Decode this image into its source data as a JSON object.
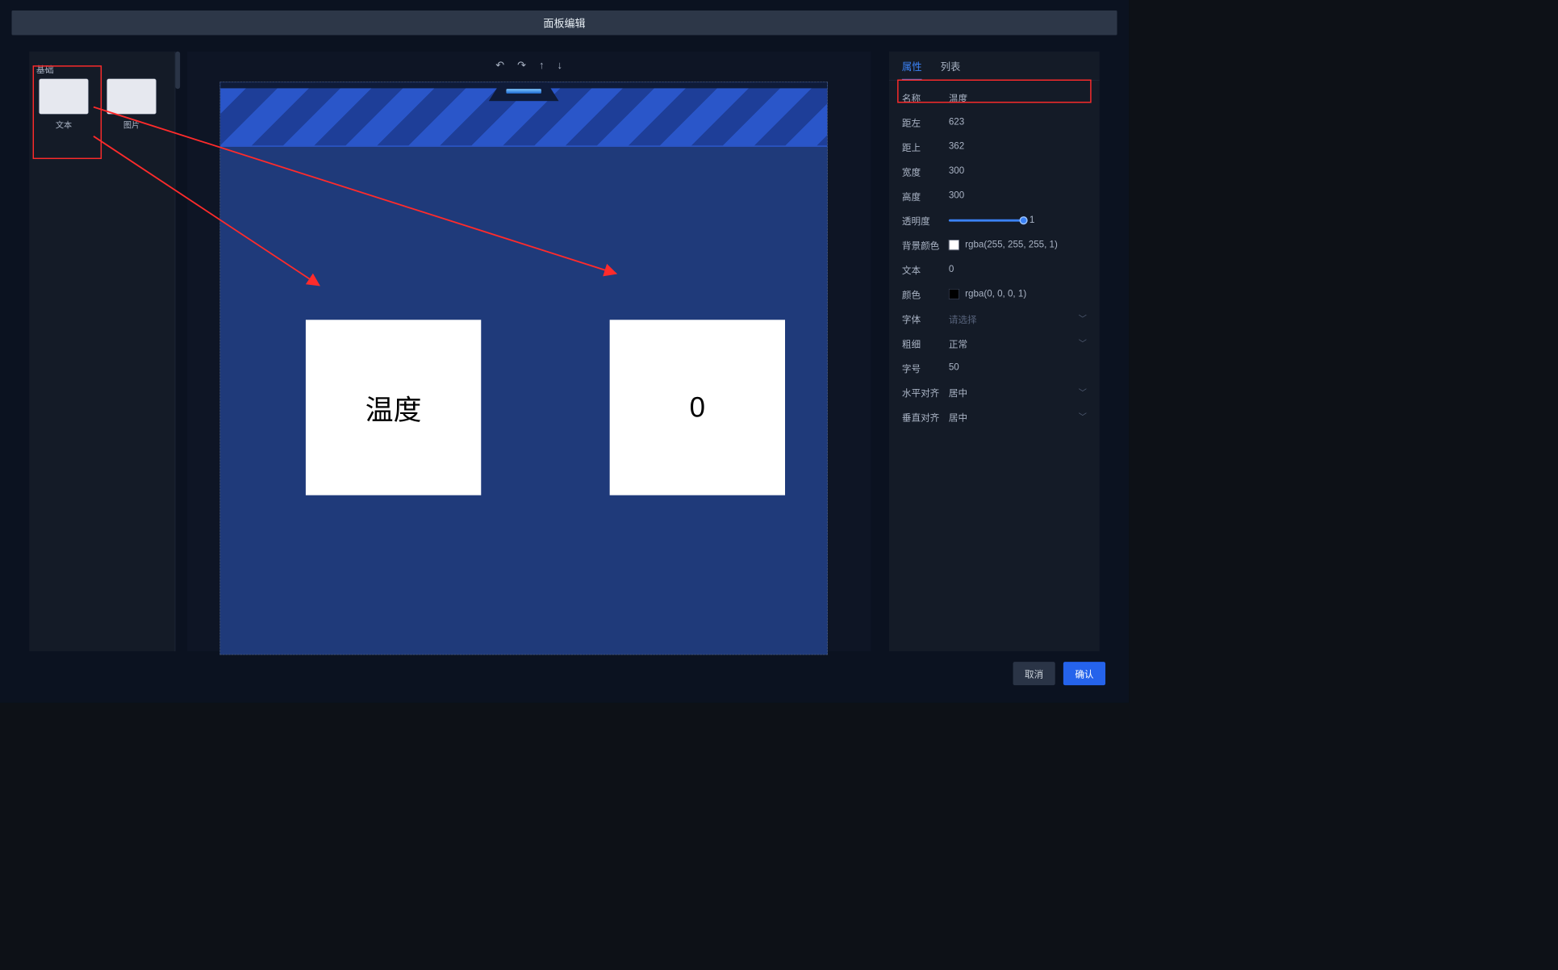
{
  "title": "面板编辑",
  "left": {
    "section": "基础",
    "items": [
      {
        "label": "文本"
      },
      {
        "label": "图片"
      }
    ]
  },
  "toolbar": {
    "undo": "↶",
    "redo": "↷",
    "up": "↑",
    "down": "↓"
  },
  "canvas": {
    "cards": {
      "temp": "温度",
      "value": "0"
    }
  },
  "right": {
    "tabs": {
      "attr": "属性",
      "list": "列表"
    },
    "rows": {
      "name_k": "名称",
      "name_v": "温度",
      "left_k": "距左",
      "left_v": "623",
      "top_k": "距上",
      "top_v": "362",
      "width_k": "宽度",
      "width_v": "300",
      "height_k": "高度",
      "height_v": "300",
      "opacity_k": "透明度",
      "opacity_v": "1",
      "bg_k": "背景颜色",
      "bg_v": "rgba(255, 255, 255, 1)",
      "text_k": "文本",
      "text_v": "0",
      "color_k": "颜色",
      "color_v": "rgba(0, 0, 0, 1)",
      "font_k": "字体",
      "font_v": "请选择",
      "weight_k": "粗细",
      "weight_v": "正常",
      "size_k": "字号",
      "size_v": "50",
      "halign_k": "水平对齐",
      "halign_v": "居中",
      "valign_k": "垂直对齐",
      "valign_v": "居中"
    }
  },
  "footer": {
    "cancel": "取消",
    "confirm": "确认"
  },
  "colors": {
    "bg_swatch": "#ffffff",
    "fg_swatch": "#000000"
  }
}
